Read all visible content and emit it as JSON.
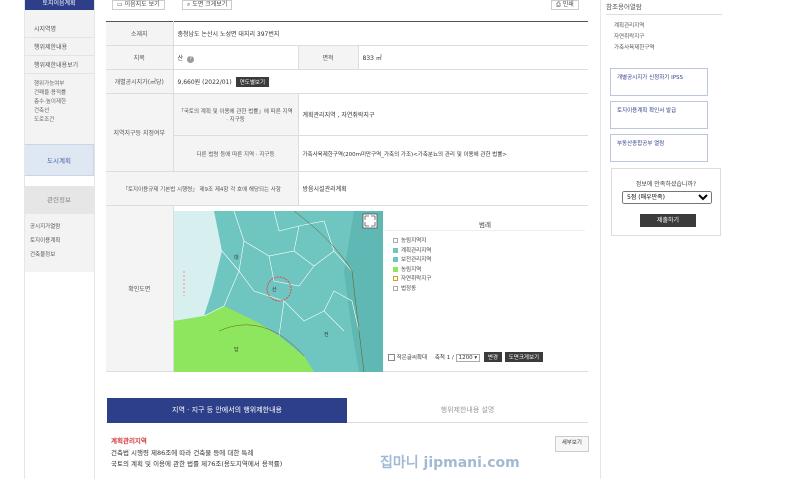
{
  "left_nav": {
    "header": "토지이음계획",
    "items": [
      "시지역명",
      "행위제한내용",
      "행위제한내용보기"
    ],
    "sub_items": [
      "행위가능여부",
      "건폐율·용적률",
      "층수·높이제한",
      "건축선",
      "도로조건"
    ],
    "active": "도시계획",
    "related_title": "관련정보",
    "related_items": [
      "공시지가열람",
      "토지이용계획",
      "건축물정보"
    ]
  },
  "toolbar": {
    "map_btn": "이음지도 보기",
    "zoom_btn": "도면 크게보기",
    "print_btn": "인쇄"
  },
  "info": {
    "location_label": "소재지",
    "location_value": "충청남도 논산시 노성면 대지리 397번지",
    "category_label": "지목",
    "category_value": "산",
    "area_label": "면적",
    "area_value": "833 ㎡",
    "price_label": "개별공시지가(㎡당)",
    "price_value": "9,660원 (2022/01)",
    "price_btn": "연도별보기",
    "zone_label": "지역지구등 지정여부",
    "zone_sub1_label": "「국토의 계획 및 이용에 관한 법률」에 따른 지역 · 지구등",
    "zone_sub1_value": "계획관리지역 , 자연취락지구",
    "zone_sub2_label": "다른 법령 등에 따른 지역 · 지구등",
    "zone_sub2_value": "가축사육제한구역(200m미만구역_가축의 가조)<가축분뇨의 관리 및 이용에 관한 법률>",
    "reg_label": "「토지이용규제 기본법 시행령」 제9조 제4항 각 호에 해당되는 사항",
    "reg_value": "방음시설관리계획",
    "map_label": "확인도면"
  },
  "legend": {
    "title": "범례",
    "items": [
      "농림지역지",
      "계획관리지역",
      "보전관리지역",
      "농림지역",
      "자연취락지구",
      "법정동"
    ],
    "colors": [
      "#ffffff",
      "#6fc5c0",
      "#6fc5c0",
      "#8ee65f",
      "#ffffff",
      "#ffffff"
    ]
  },
  "map": {
    "labels": [
      "산",
      "대",
      "전",
      "답"
    ]
  },
  "map_controls": {
    "checkbox_label": "작은글씨확대",
    "scale_label": "축척 1 /",
    "scale_value": "1200",
    "change_btn": "변경",
    "zoom_btn": "도면크게보기"
  },
  "tabs": {
    "active": "지역 · 지구 등 안에서의 행위제한내용",
    "inactive": "행위제한내용 설명"
  },
  "content": {
    "title": "계획관리지역",
    "button": "세부보기",
    "lines": [
      "건축법 시행령 제86조에 따라 건축물 등에 대한 특례",
      "국토의 계획 및 이용에 관한 법률 제76조(용도지역에서 용적률)"
    ]
  },
  "right_sidebar": {
    "title": "참조용어열람",
    "items": [
      "계획관리지역",
      "자연취락지구",
      "가축사육제한구역"
    ],
    "banners": [
      "개별공시지가 신청하기 IPSS",
      "토지이용계획 확인서 발급",
      "부동산종합공부 열람"
    ],
    "poll_question": "정보에 만족하셨습니까?",
    "poll_selected": "5점 (매우만족)",
    "poll_button": "제출하기"
  },
  "watermark": "집마니 jipmani.com"
}
